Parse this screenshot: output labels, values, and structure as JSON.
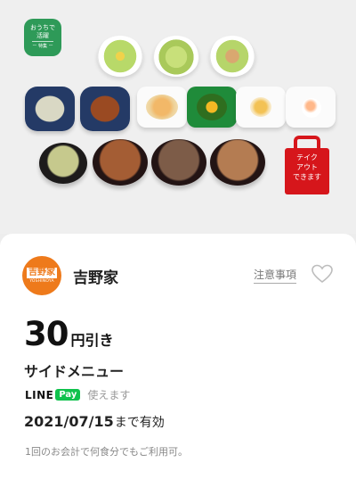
{
  "hero": {
    "badge_line1": "おうちで",
    "badge_line2": "活躍",
    "badge_line3": "ー 特集 ー",
    "takeout_label": [
      "テイク",
      "アウト",
      "できます"
    ],
    "colors": {
      "badge": "#2e9a58",
      "takeout": "#d6161b"
    }
  },
  "store": {
    "logo_kanji": "吉野家",
    "logo_roman": "YOSHINOYA",
    "name": "吉野家",
    "notes_link": "注意事項",
    "brand_color": "#ee7a1b"
  },
  "coupon": {
    "amount": "30",
    "unit": "円引き",
    "item": "サイドメニュー",
    "payment": {
      "line": "LINE",
      "pay": "Pay",
      "usable": "使えます",
      "pay_color": "#10c24d"
    },
    "valid_date": "2021/07/15",
    "valid_suffix": "まで有効",
    "footnote": "1回のお会計で何食分でもご利用可。"
  }
}
